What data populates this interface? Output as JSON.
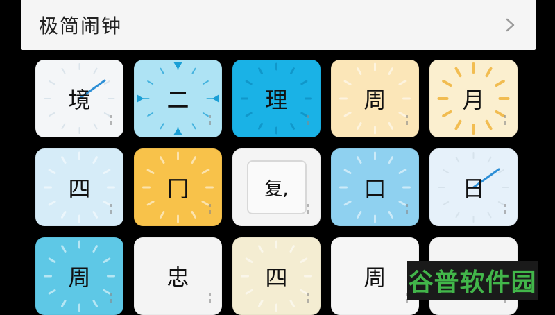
{
  "header": {
    "title": "极简闹钟",
    "chevron_icon": "chevron-right-icon"
  },
  "tiles": [
    {
      "label": "境",
      "bg": "#f4f6f8",
      "style": "hand-blue"
    },
    {
      "label": "二",
      "bg": "#aee3f4",
      "style": "triangles"
    },
    {
      "label": "理",
      "bg": "#1ab2e6",
      "style": "ticks-dark"
    },
    {
      "label": "周",
      "bg": "#fbe6b8",
      "style": "ticks-light"
    },
    {
      "label": "月",
      "bg": "#fbefcf",
      "style": "ticks-gold"
    },
    {
      "label": "四",
      "bg": "#d6ecf8",
      "style": "ticks-light"
    },
    {
      "label": "冂",
      "bg": "#f8c24a",
      "style": "ticks-light"
    },
    {
      "label": "复,",
      "bg": "#f4f4f4",
      "style": "boxed"
    },
    {
      "label": "口",
      "bg": "#8fd1f0",
      "style": "ticks-light"
    },
    {
      "label": "日",
      "bg": "#e6f1fa",
      "style": "hand-blue"
    },
    {
      "label": "周",
      "bg": "#5ec8e6",
      "style": "ticks-light"
    },
    {
      "label": "忠",
      "bg": "#f4f4f4",
      "style": "plain"
    },
    {
      "label": "四",
      "bg": "#f4edd2",
      "style": "ticks-light"
    },
    {
      "label": "周",
      "bg": "#f6f6f6",
      "style": "plain"
    },
    {
      "label": "",
      "bg": "#f4f4f4",
      "style": "plain"
    }
  ],
  "watermark": {
    "text": "谷普软件园",
    "color": "#42b64a"
  }
}
